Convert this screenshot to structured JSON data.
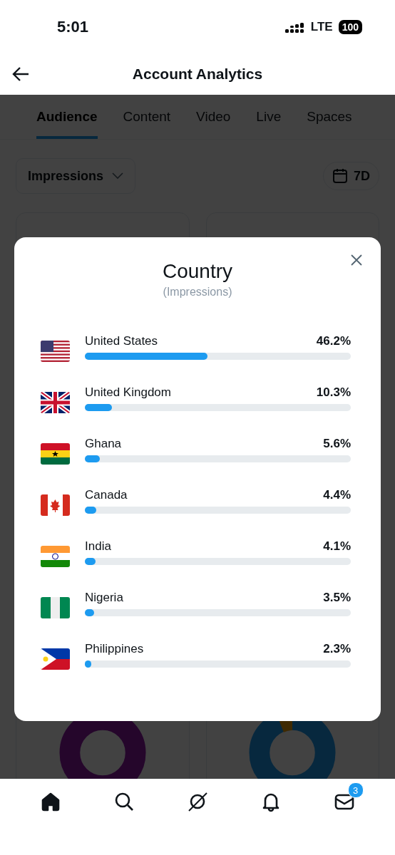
{
  "status_bar": {
    "time": "5:01",
    "network": "LTE",
    "battery": "100"
  },
  "header": {
    "title": "Account Analytics"
  },
  "tabs": [
    {
      "label": "Audience",
      "selected": true
    },
    {
      "label": "Content",
      "selected": false
    },
    {
      "label": "Video",
      "selected": false
    },
    {
      "label": "Live",
      "selected": false
    },
    {
      "label": "Spaces",
      "selected": false
    }
  ],
  "metric_dropdown": {
    "value": "Impressions"
  },
  "date_range": {
    "label": "7D"
  },
  "modal": {
    "title": "Country",
    "subtitle": "(Impressions)",
    "rows": [
      {
        "name": "United States",
        "value": "46.2%",
        "level": 0.462
      },
      {
        "name": "United Kingdom",
        "value": "10.3%",
        "level": 0.103
      },
      {
        "name": "Ghana",
        "value": "5.6%",
        "level": 0.056
      },
      {
        "name": "Canada",
        "value": "4.4%",
        "level": 0.044
      },
      {
        "name": "India",
        "value": "4.1%",
        "level": 0.041
      },
      {
        "name": "Nigeria",
        "value": "3.5%",
        "level": 0.035
      },
      {
        "name": "Philippines",
        "value": "2.3%",
        "level": 0.023
      }
    ]
  },
  "bottom_nav": [
    {
      "kind": "home",
      "selected": true
    },
    {
      "kind": "search",
      "selected": false
    },
    {
      "kind": "grok",
      "selected": false
    },
    {
      "kind": "notifications",
      "selected": false
    },
    {
      "kind": "messages",
      "selected": false,
      "badge": "3"
    }
  ]
}
